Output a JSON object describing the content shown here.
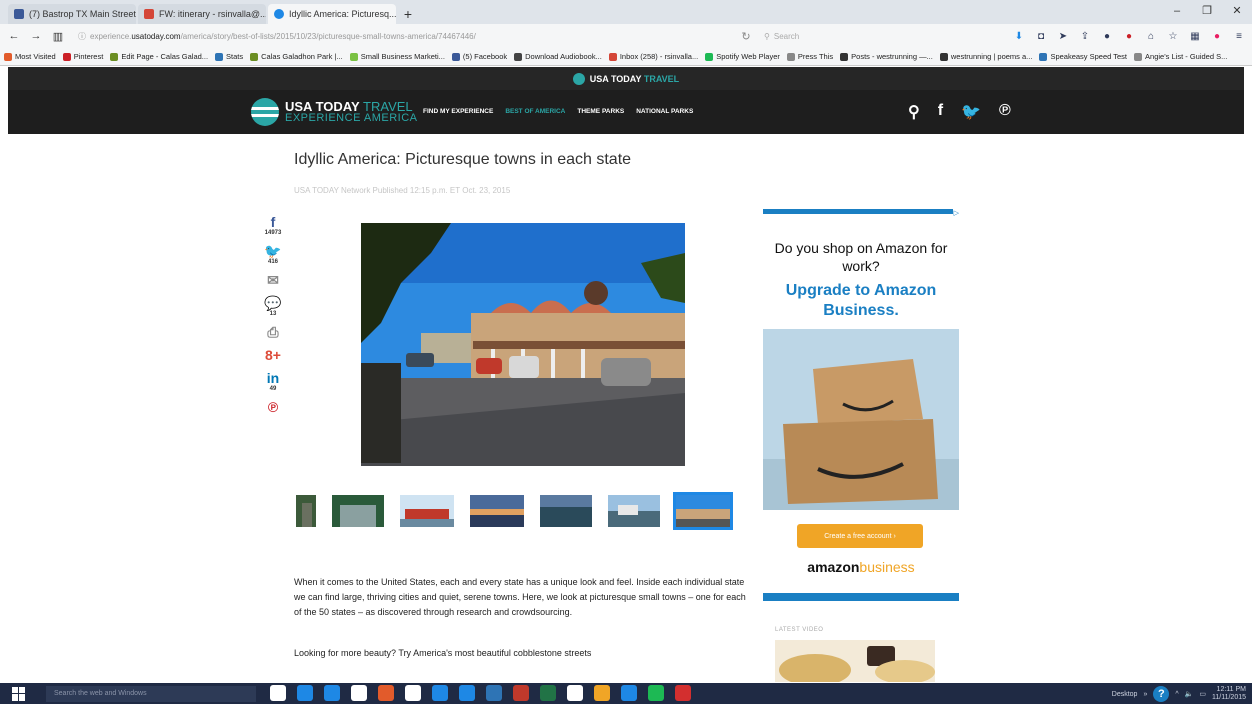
{
  "browser": {
    "tabs": [
      {
        "label": "(7) Bastrop TX Main Street",
        "color": "#3b5998",
        "active": false
      },
      {
        "label": "FW: itinerary - rsinvalla@...",
        "color": "#d44638",
        "active": false
      },
      {
        "label": "Idyllic America: Picturesq...",
        "color": "#1e88e5",
        "active": true
      }
    ],
    "url_prefix": "experience.",
    "url_domain": "usatoday.com",
    "url_rest": "/america/story/best-of-lists/2015/10/23/picturesque-small-towns-america/74467446/",
    "search_placeholder": "Search",
    "bookmarks": [
      {
        "label": "Most Visited",
        "color": "#e25b2b"
      },
      {
        "label": "Pinterest",
        "color": "#cb2027"
      },
      {
        "label": "Edit Page - Calas Galad...",
        "color": "#6b8e23"
      },
      {
        "label": "Stats",
        "color": "#2e74b5"
      },
      {
        "label": "Calas Galadhon Park |...",
        "color": "#6b8e23"
      },
      {
        "label": "Small Business Marketi...",
        "color": "#7ac143"
      },
      {
        "label": "(5) Facebook",
        "color": "#3b5998"
      },
      {
        "label": "Download Audiobook...",
        "color": "#444"
      },
      {
        "label": "Inbox (258) - rsinvalla...",
        "color": "#d44638"
      },
      {
        "label": "Spotify Web Player",
        "color": "#1db954"
      },
      {
        "label": "Press This",
        "color": "#888"
      },
      {
        "label": "Posts - westrunning —...",
        "color": "#333"
      },
      {
        "label": "westrunning | poems a...",
        "color": "#333"
      },
      {
        "label": "Speakeasy Speed Test",
        "color": "#2e74b5"
      },
      {
        "label": "Angie's List - Guided S...",
        "color": "#888"
      }
    ]
  },
  "site": {
    "strip_brand": "USA TODAY",
    "strip_accent": "TRAVEL",
    "logo_line1": "USA TODAY",
    "logo_line1_accent": "TRAVEL",
    "logo_line2": "EXPERIENCE AMERICA",
    "menu": [
      "FIND MY EXPERIENCE",
      "BEST OF AMERICA",
      "THEME PARKS",
      "NATIONAL PARKS"
    ],
    "menu_active_index": 1,
    "accent_color": "#2ba6a6"
  },
  "article": {
    "title": "Idyllic America: Picturesque towns in each state",
    "byline": "USA TODAY Network Published 12:15 p.m. ET Oct. 23, 2015",
    "share": [
      {
        "icon": "facebook-icon",
        "glyph": "f",
        "count": "14973",
        "color": "#3b5998"
      },
      {
        "icon": "twitter-icon",
        "glyph": "🐦",
        "count": "416",
        "color": "#1da1f2"
      },
      {
        "icon": "email-icon",
        "glyph": "✉",
        "count": "",
        "color": "#8a8a8a"
      },
      {
        "icon": "comment-icon",
        "glyph": "💬",
        "count": "13",
        "color": "#8a8a8a"
      },
      {
        "icon": "print-icon",
        "glyph": "⎙",
        "count": "",
        "color": "#8a8a8a"
      },
      {
        "icon": "google-plus-icon",
        "glyph": "8+",
        "count": "",
        "color": "#dd4b39"
      },
      {
        "icon": "linkedin-icon",
        "glyph": "in",
        "count": "49",
        "color": "#0077b5"
      },
      {
        "icon": "pinterest-icon",
        "glyph": "℗",
        "count": "",
        "color": "#cb2027"
      }
    ],
    "paragraph": "When it comes to the United States, each and every state has a unique look and feel. Inside each individual state we can find large, thriving cities and quiet, serene towns. Here, we look at picturesque small towns – one for each of the 50 states – as discovered through research and crowdsourcing.",
    "paragraph2": "Looking for more beauty? Try America's most beautiful cobblestone streets"
  },
  "ad": {
    "question": "Do you shop on Amazon for work?",
    "upgrade": "Upgrade to Amazon Business.",
    "cta": "Create a free account  ›",
    "brand_a": "amazon",
    "brand_b": "business",
    "latest_video": "LATEST VIDEO"
  },
  "taskbar": {
    "search_placeholder": "Search the web and Windows",
    "desktop_label": "Desktop",
    "help_glyph": "?",
    "time": "12:11 PM",
    "date": "11/11/2015",
    "apps": [
      "#ffffff",
      "#1e88e5",
      "#1e88e5",
      "#ffffff",
      "#e25b2b",
      "#ffffff",
      "#1e88e5",
      "#1e88e5",
      "#2e74b5",
      "#c0392b",
      "#217346",
      "#ffffff",
      "#f0a526",
      "#1e88e5",
      "#1db954",
      "#d32f2f"
    ]
  }
}
